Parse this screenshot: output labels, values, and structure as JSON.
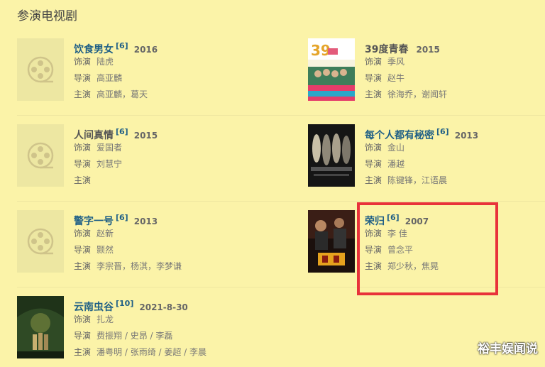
{
  "section_title": "参演电视剧",
  "labels": {
    "role": "饰演",
    "director": "导演",
    "cast": "主演"
  },
  "items": [
    {
      "title": "饮食男女",
      "note": "[6]",
      "year": "2016",
      "role": "陆虎",
      "director": "高亚麟",
      "cast": "高亚麟，葛天",
      "poster": "none"
    },
    {
      "title": "39度青春",
      "note": "",
      "year": "2015",
      "role": "季风",
      "director": "赵牛",
      "cast": "徐海乔，谢闻轩",
      "poster": "poster-39du"
    },
    {
      "title": "人间真情",
      "note": "[6]",
      "year": "2015",
      "role": "爱国者",
      "director": "刘慧宁",
      "cast": "",
      "poster": "none"
    },
    {
      "title": "每个人都有秘密",
      "note": "[6]",
      "year": "2013",
      "role": "金山",
      "director": "潘越",
      "cast": "陈键锋，江语晨",
      "poster": "poster-secret"
    },
    {
      "title": "警字一号",
      "note": "[6]",
      "year": "2013",
      "role": "赵新",
      "director": "颢然",
      "cast": "李宗晋，杨淇，李梦谦",
      "poster": "none"
    },
    {
      "title": "荣归",
      "note": "[6]",
      "year": "2007",
      "role": "李 佳",
      "director": "曾念平",
      "cast": "郑少秋，焦晃",
      "poster": "poster-ronggui"
    },
    {
      "title": "云南虫谷",
      "note": "[10]",
      "year": "2021-8-30",
      "role": "扎龙",
      "director": "费振翔 / 史昂 / 李磊",
      "cast": "潘粤明 / 张雨绮 / 姜超 / 李晨",
      "poster": "poster-yunnan"
    }
  ],
  "watermark": "裕丰娱闻说",
  "colors": {
    "background": "#fbf3a8",
    "title_link": "#1f5f86",
    "highlight_border": "#e8323a"
  }
}
